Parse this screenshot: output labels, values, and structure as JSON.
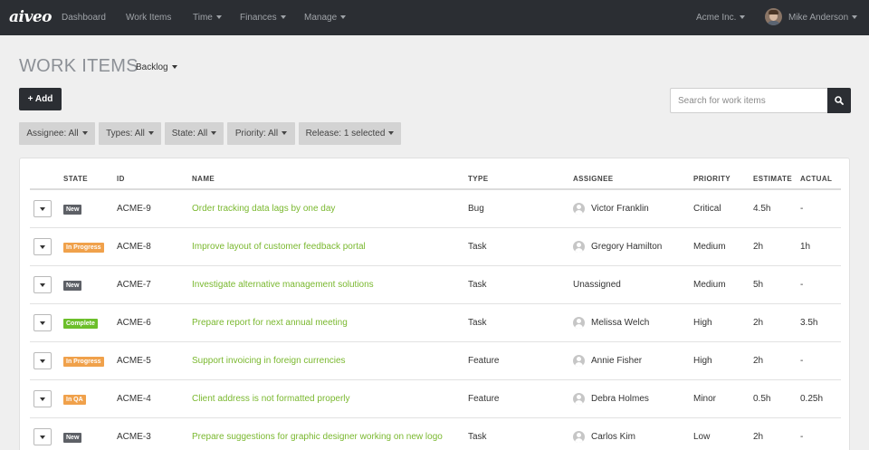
{
  "nav": {
    "brand": "aiveo",
    "items": [
      "Dashboard",
      "Work Items",
      "Time",
      "Finances",
      "Manage"
    ],
    "org": "Acme Inc.",
    "user": "Mike Anderson"
  },
  "header": {
    "title": "WORK ITEMS",
    "view": "Backlog",
    "add_label": "+ Add",
    "search_placeholder": "Search for work items"
  },
  "filters": [
    "Assignee: All",
    "Types: All",
    "State: All",
    "Priority: All",
    "Release: 1 selected"
  ],
  "table": {
    "columns": [
      "STATE",
      "ID",
      "NAME",
      "TYPE",
      "ASSIGNEE",
      "PRIORITY",
      "ESTIMATE",
      "ACTUAL"
    ],
    "rows": [
      {
        "state": "New",
        "id": "ACME-9",
        "name": "Order tracking data lags by one day",
        "type": "Bug",
        "assignee": "Victor Franklin",
        "priority": "Critical",
        "estimate": "4.5h",
        "actual": "-"
      },
      {
        "state": "In Progress",
        "id": "ACME-8",
        "name": "Improve layout of customer feedback portal",
        "type": "Task",
        "assignee": "Gregory Hamilton",
        "priority": "Medium",
        "estimate": "2h",
        "actual": "1h"
      },
      {
        "state": "New",
        "id": "ACME-7",
        "name": "Investigate alternative management solutions",
        "type": "Task",
        "assignee": "Unassigned",
        "priority": "Medium",
        "estimate": "5h",
        "actual": "-"
      },
      {
        "state": "Complete",
        "id": "ACME-6",
        "name": "Prepare report for next annual meeting",
        "type": "Task",
        "assignee": "Melissa Welch",
        "priority": "High",
        "estimate": "2h",
        "actual": "3.5h"
      },
      {
        "state": "In Progress",
        "id": "ACME-5",
        "name": "Support invoicing in foreign currencies",
        "type": "Feature",
        "assignee": "Annie Fisher",
        "priority": "High",
        "estimate": "2h",
        "actual": "-"
      },
      {
        "state": "In QA",
        "id": "ACME-4",
        "name": "Client address is not formatted properly",
        "type": "Feature",
        "assignee": "Debra Holmes",
        "priority": "Minor",
        "estimate": "0.5h",
        "actual": "0.25h"
      },
      {
        "state": "New",
        "id": "ACME-3",
        "name": "Prepare suggestions for graphic designer working on new logo",
        "type": "Task",
        "assignee": "Carlos Kim",
        "priority": "Low",
        "estimate": "2h",
        "actual": "-"
      }
    ]
  },
  "colors": {
    "navbar": "#2b2e33",
    "link_green": "#7ab82f",
    "state_new": "#5d6066",
    "state_in_progress": "#f0a14b",
    "state_complete": "#6cbf2a",
    "state_in_qa": "#f0a14b"
  }
}
